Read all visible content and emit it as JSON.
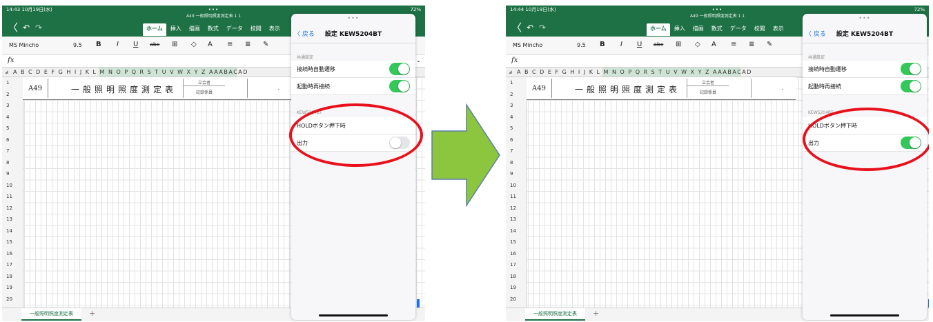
{
  "screens": [
    {
      "status": {
        "time": "14:43  10月19日(水)",
        "dots": "•••",
        "battery": "72%"
      },
      "doc_title": "A49 一般照明照度測定表 1 1",
      "toolbar": {
        "font": "MS Mincho",
        "size": "9.5"
      },
      "panel": {
        "back": "〈 戻る",
        "title": "設定 KEW5204BT",
        "section1": "共通設定",
        "row1": "接続時自動遷移",
        "row2": "起動時再接続",
        "section2": "KEW5204BT",
        "row3": "HOLDボタン押下時",
        "row4": "出力"
      },
      "toggles": {
        "row1": true,
        "row2": true,
        "row4": false
      }
    },
    {
      "status": {
        "time": "14:44  10月19日(水)",
        "dots": "•••",
        "battery": "72%"
      },
      "doc_title": "A49 一般照明照度測定表 1 1",
      "toolbar": {
        "font": "MS Mincho",
        "size": "9.5"
      },
      "panel": {
        "back": "〈 戻る",
        "title": "設定 KEW5204BT",
        "section1": "共通設定",
        "row1": "接続時自動遷移",
        "row2": "起動時再接続",
        "section2": "KEW5204BT",
        "row3": "HOLDボタン押下時",
        "row4": "出力"
      },
      "toggles": {
        "row1": true,
        "row2": true,
        "row4": true
      }
    }
  ],
  "ribbon_tabs": [
    "ホーム",
    "挿入",
    "描画",
    "数式",
    "データ",
    "校閲",
    "表示"
  ],
  "column_letters": "A B C D E F G H I J K L M N O P Q R S T U V  W   X Y Z AAABACAD",
  "rows": [
    "1",
    "2",
    "3",
    "4",
    "5",
    "6",
    "7",
    "8",
    "9",
    "10",
    "11",
    "12",
    "13",
    "14",
    "15",
    "16",
    "17",
    "18",
    "19",
    "20"
  ],
  "sheet": {
    "code": "A49",
    "title": "一般照明照度測定表",
    "label_top": "立会者",
    "label_bottom": "記録係員",
    "dash": "-",
    "tab": "一般照明照度測定表",
    "add": "+"
  },
  "icons": {
    "fx": "fx",
    "chevron": "⌄",
    "back": "〈",
    "undo": "↶",
    "redo": "↷"
  },
  "colors": {
    "excel_green": "#1e7145",
    "toggle_on": "#34c759",
    "highlight": "#e8111b",
    "arrow": "#8cc63f",
    "link": "#1a73e8"
  }
}
